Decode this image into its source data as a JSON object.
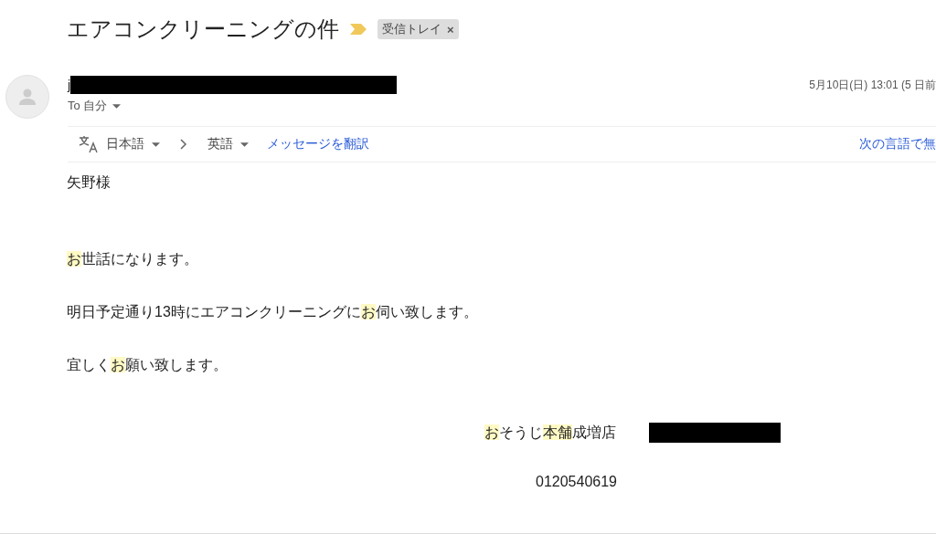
{
  "subject": "エアコンクリーニングの件",
  "label": {
    "text": "受信トレイ",
    "close": "×"
  },
  "sender": {
    "name": "j",
    "redacted": true,
    "recipient": "To 自分",
    "date": "5月10日(日) 13:01 (5 日前"
  },
  "translate": {
    "source": "日本語",
    "target": "英語",
    "action": "メッセージを翻訳",
    "never": "次の言語で無"
  },
  "body": [
    [
      {
        "text": "矢野様",
        "highlighted": false
      }
    ],
    [
      {
        "text": "お",
        "highlighted": true
      },
      {
        "text": "世話になります。",
        "highlighted": false
      }
    ],
    [
      {
        "text": "明日予定通り13時にエアコンクリーニングに",
        "highlighted": false
      },
      {
        "text": "お",
        "highlighted": true
      },
      {
        "text": "伺い致します。",
        "highlighted": false
      }
    ],
    [
      {
        "text": "宜しく",
        "highlighted": false
      },
      {
        "text": "お",
        "highlighted": true
      },
      {
        "text": "願い致します。",
        "highlighted": false
      }
    ]
  ],
  "signature": {
    "line": [
      {
        "text": "お",
        "highlighted": true
      },
      {
        "text": "そうじ",
        "highlighted": false
      },
      {
        "text": "本舗",
        "highlighted": true
      },
      {
        "text": "成増店",
        "highlighted": false
      }
    ],
    "redacted": true,
    "phone": "0120540619"
  }
}
